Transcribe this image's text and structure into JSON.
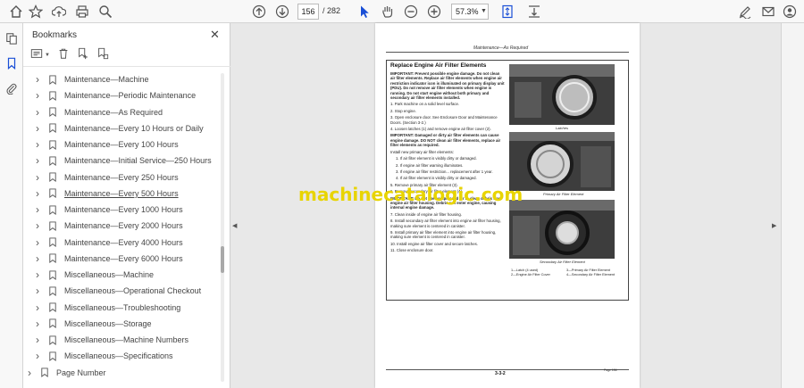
{
  "toolbar": {
    "page_current": "156",
    "page_total": "/ 282",
    "zoom": "57.3%"
  },
  "panel": {
    "title": "Bookmarks",
    "close": "✕"
  },
  "bookmarks": [
    {
      "label": "Maintenance—Machine"
    },
    {
      "label": "Maintenance—Periodic Maintenance"
    },
    {
      "label": "Maintenance—As Required"
    },
    {
      "label": "Maintenance—Every 10 Hours or Daily"
    },
    {
      "label": "Maintenance—Every 100 Hours"
    },
    {
      "label": "Maintenance—Initial Service—250 Hours"
    },
    {
      "label": "Maintenance—Every 250 Hours"
    },
    {
      "label": "Maintenance—Every 500 Hours"
    },
    {
      "label": "Maintenance—Every 1000 Hours"
    },
    {
      "label": "Maintenance—Every 2000 Hours"
    },
    {
      "label": "Maintenance—Every 4000 Hours"
    },
    {
      "label": "Maintenance—Every 6000 Hours"
    },
    {
      "label": "Miscellaneous—Machine"
    },
    {
      "label": "Miscellaneous—Operational Checkout"
    },
    {
      "label": "Miscellaneous—Troubleshooting"
    },
    {
      "label": "Miscellaneous—Storage"
    },
    {
      "label": "Miscellaneous—Machine Numbers"
    },
    {
      "label": "Miscellaneous—Specifications"
    },
    {
      "label": "Page Number"
    }
  ],
  "document": {
    "header": "Maintenance—As Required",
    "section_title": "Replace Engine Air Filter Elements",
    "important1": "IMPORTANT: Prevent possible engine damage. Do not clean air filter elements. Replace air filter elements when engine air restriction indicator icon is illuminated on primary display unit (PDU). Do not remove air filter elements when engine is running. Do not start engine without both primary and secondary air filter elements installed.",
    "steps_a": [
      "1. Park machine on a solid level surface.",
      "2. Stop engine.",
      "3. Open enclosure door. See Enclosure Door and Maintenance Doors. (Section 3-2.)",
      "4. Loosen latches (1) and remove engine air filter cover (2)."
    ],
    "important2": "IMPORTANT: Damaged or dirty air filter elements can cause engine damage. DO NOT clean air filter elements, replace air filter elements as required.",
    "install_header": "Install new primary air filter elements:",
    "install_items": [
      "1. If air filter element is visibly dirty or damaged.",
      "2. If engine air filter warning illuminates.",
      "3. If engine air filter restriction... replacement after 1 year.",
      "4. If air filter element is visibly dirty or damaged."
    ],
    "steps_b": [
      "5. Remove primary air filter element (3).",
      "6. Remove secondary air filter element (4)."
    ],
    "important3": "IMPORTANT: Do not use compressed air to clean debris from engine air filter housing. Debris can enter engine, causing internal engine damage.",
    "steps_c": [
      "7. Clean inside of engine air filter housing.",
      "8. Install secondary air filter element into engine air filter housing, making sure element is centered in canister.",
      "9. Install primary air filter element into engine air filter housing, making sure element is centered in canister.",
      "10. Install engine air filter cover and secure latches.",
      "11. Close enclosure door."
    ],
    "caption1": "Latches",
    "caption2": "Primary Air Filter Element",
    "caption3": "Secondary Air Filter Element",
    "legend_left": [
      "1—Latch (4 used)",
      "2—Engine Air Filter Cover"
    ],
    "legend_right": [
      "3—Primary Air Filter Element",
      "4—Secondary Air Filter Element"
    ],
    "footer_page": "3-3-2",
    "footer_right": "Page 156"
  },
  "watermark": "machinecatalogic.com"
}
